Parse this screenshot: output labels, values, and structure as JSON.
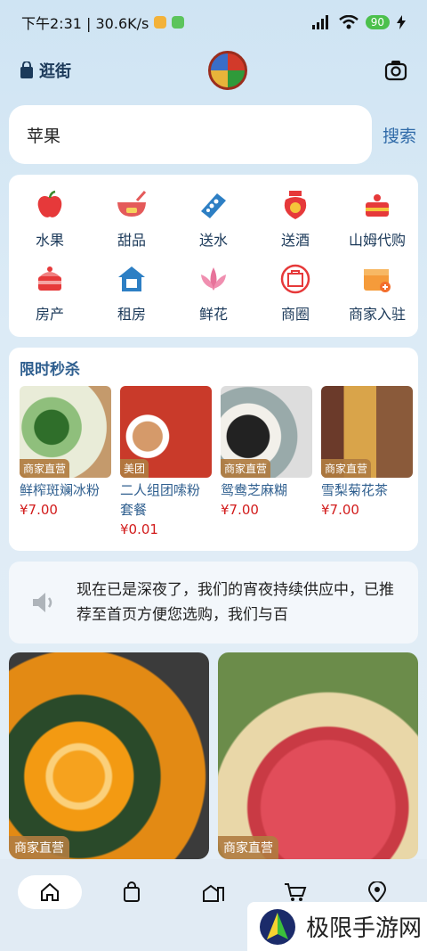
{
  "status_bar": {
    "time_speed": "下午2:31 | 30.6K/s",
    "battery": "90"
  },
  "header": {
    "left_label": "逛街"
  },
  "search": {
    "value": "苹果",
    "button": "搜索"
  },
  "categories": [
    {
      "label": "水果",
      "icon": "apple-icon"
    },
    {
      "label": "甜品",
      "icon": "dessert-bowl-icon"
    },
    {
      "label": "送水",
      "icon": "water-delivery-icon"
    },
    {
      "label": "送酒",
      "icon": "liquor-jar-icon"
    },
    {
      "label": "山姆代购",
      "icon": "cake-icon"
    },
    {
      "label": "房产",
      "icon": "cake-house-icon"
    },
    {
      "label": "租房",
      "icon": "rent-house-icon"
    },
    {
      "label": "鲜花",
      "icon": "lily-flower-icon"
    },
    {
      "label": "商圈",
      "icon": "shop-circle-icon"
    },
    {
      "label": "商家入驻",
      "icon": "store-join-icon"
    }
  ],
  "flash_sale": {
    "title": "限时秒杀",
    "items": [
      {
        "tag": "商家直营",
        "name": "鲜榨斑斓冰粉",
        "price": "¥7.00"
      },
      {
        "tag": "美团",
        "name": "二人组团嗦粉套餐",
        "price": "¥0.01"
      },
      {
        "tag": "商家直营",
        "name": "鸳鸯芝麻糊",
        "price": "¥7.00"
      },
      {
        "tag": "商家直营",
        "name": "雪梨菊花茶",
        "price": "¥7.00"
      }
    ]
  },
  "notice": {
    "text": "现在已是深夜了，我们的宵夜持续供应中，已推荐至首页方便您选购，我们与百"
  },
  "products": [
    {
      "tag": "商家直营"
    },
    {
      "tag": "商家直营"
    }
  ],
  "bottom_nav": [
    {
      "icon": "home-icon"
    },
    {
      "icon": "shopping-bag-icon"
    },
    {
      "icon": "city-buildings-icon"
    },
    {
      "icon": "cart-icon"
    },
    {
      "icon": "location-icon"
    }
  ],
  "watermark": {
    "text": "极限手游网"
  }
}
